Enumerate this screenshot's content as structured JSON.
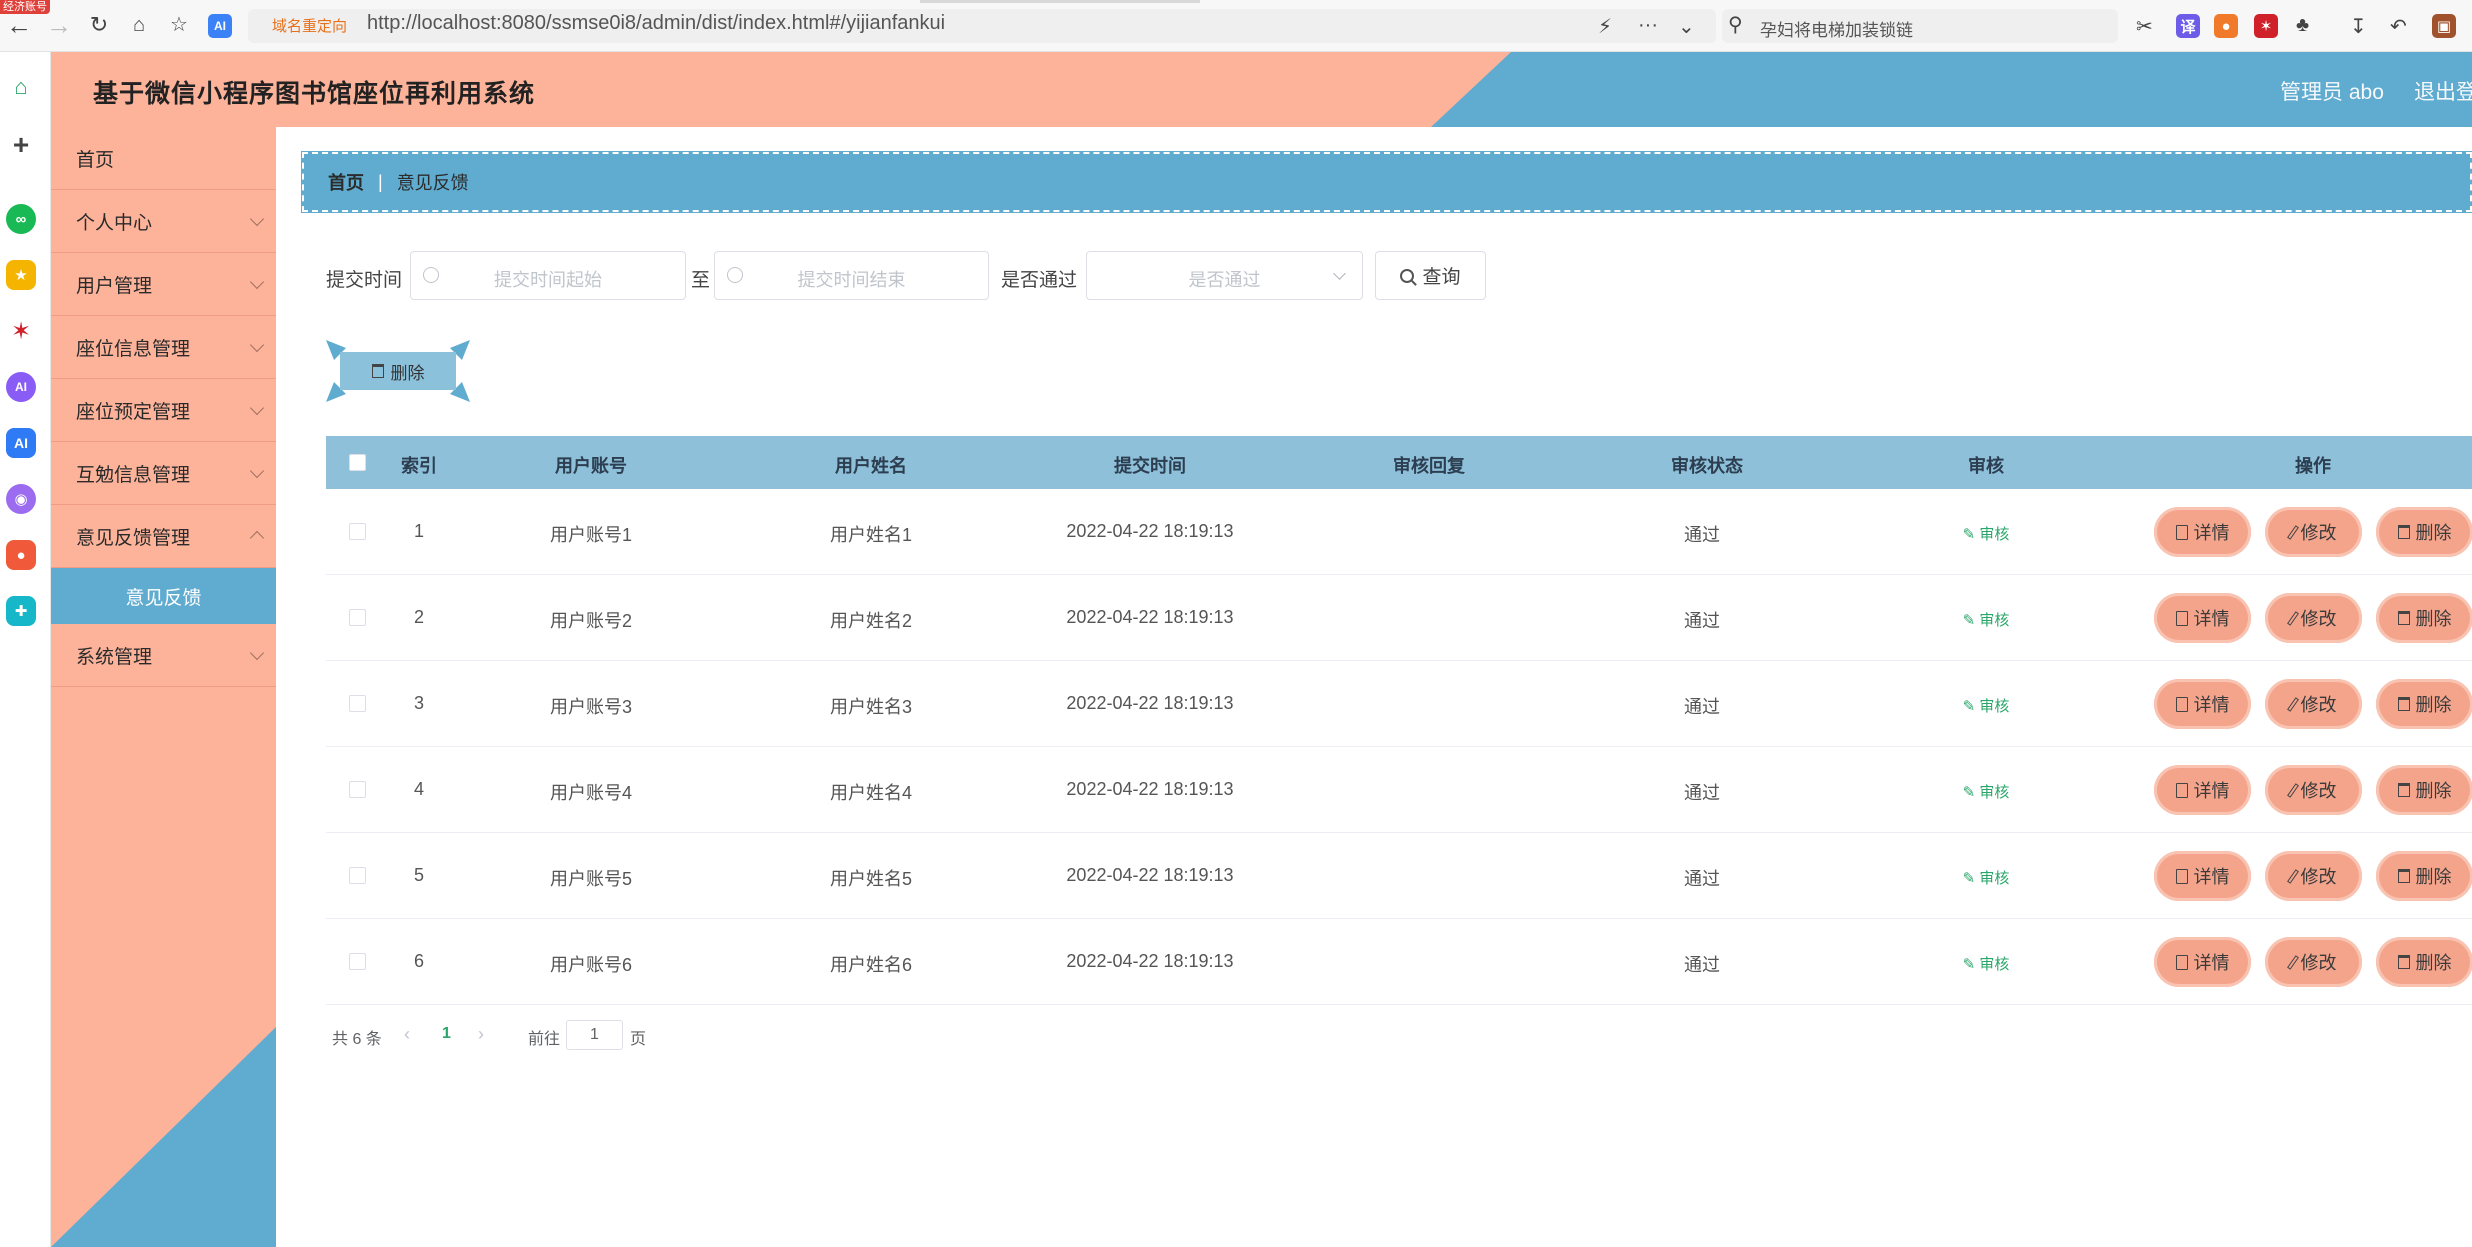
{
  "browser": {
    "corner_badge": "经济账号",
    "redirect_label": "域名重定向",
    "url": "http://localhost:8080/ssmse0i8/admin/dist/index.html#/yijianfankui",
    "search_text": "孕妇将电梯加装锁链",
    "ai_label": "AI"
  },
  "header": {
    "title": "基于微信小程序图书馆座位再利用系统",
    "user_label": "管理员 abo",
    "logout_label": "退出登"
  },
  "sidebar": {
    "items": [
      {
        "label": "首页",
        "has_chevron": false
      },
      {
        "label": "个人中心",
        "has_chevron": true
      },
      {
        "label": "用户管理",
        "has_chevron": true
      },
      {
        "label": "座位信息管理",
        "has_chevron": true
      },
      {
        "label": "座位预定管理",
        "has_chevron": true
      },
      {
        "label": "互勉信息管理",
        "has_chevron": true
      },
      {
        "label": "意见反馈管理",
        "has_chevron": true
      },
      {
        "label": "系统管理",
        "has_chevron": true
      }
    ],
    "active_sub": "意见反馈"
  },
  "breadcrumb": {
    "home": "首页",
    "separator": "|",
    "current": "意见反馈"
  },
  "filters": {
    "submit_time_label": "提交时间",
    "start_placeholder": "提交时间起始",
    "to_label": "至",
    "end_placeholder": "提交时间结束",
    "passed_label": "是否通过",
    "passed_placeholder": "是否通过",
    "query_label": "查询"
  },
  "bulk_delete_label": "删除",
  "table": {
    "columns": [
      "索引",
      "用户账号",
      "用户姓名",
      "提交时间",
      "审核回复",
      "审核状态",
      "审核",
      "操作"
    ],
    "rows": [
      {
        "index": "1",
        "account": "用户账号1",
        "name": "用户姓名1",
        "time": "2022-04-22 18:19:13",
        "reply": "",
        "status": "通过"
      },
      {
        "index": "2",
        "account": "用户账号2",
        "name": "用户姓名2",
        "time": "2022-04-22 18:19:13",
        "reply": "",
        "status": "通过"
      },
      {
        "index": "3",
        "account": "用户账号3",
        "name": "用户姓名3",
        "time": "2022-04-22 18:19:13",
        "reply": "",
        "status": "通过"
      },
      {
        "index": "4",
        "account": "用户账号4",
        "name": "用户姓名4",
        "time": "2022-04-22 18:19:13",
        "reply": "",
        "status": "通过"
      },
      {
        "index": "5",
        "account": "用户账号5",
        "name": "用户姓名5",
        "time": "2022-04-22 18:19:13",
        "reply": "",
        "status": "通过"
      },
      {
        "index": "6",
        "account": "用户账号6",
        "name": "用户姓名6",
        "time": "2022-04-22 18:19:13",
        "reply": "",
        "status": "通过"
      }
    ],
    "audit_link": "审核",
    "detail_label": "详情",
    "edit_label": "修改",
    "delete_label": "删除"
  },
  "pagination": {
    "total": "共 6 条",
    "current_page": "1",
    "goto_label": "前往",
    "goto_value": "1",
    "page_suffix": "页"
  },
  "colors": {
    "accent_peach": "#fdb39a",
    "accent_blue": "#5facd0",
    "table_header": "#8ec0da",
    "op_button": "#f5a48c",
    "audit_green": "#2aa66a"
  }
}
